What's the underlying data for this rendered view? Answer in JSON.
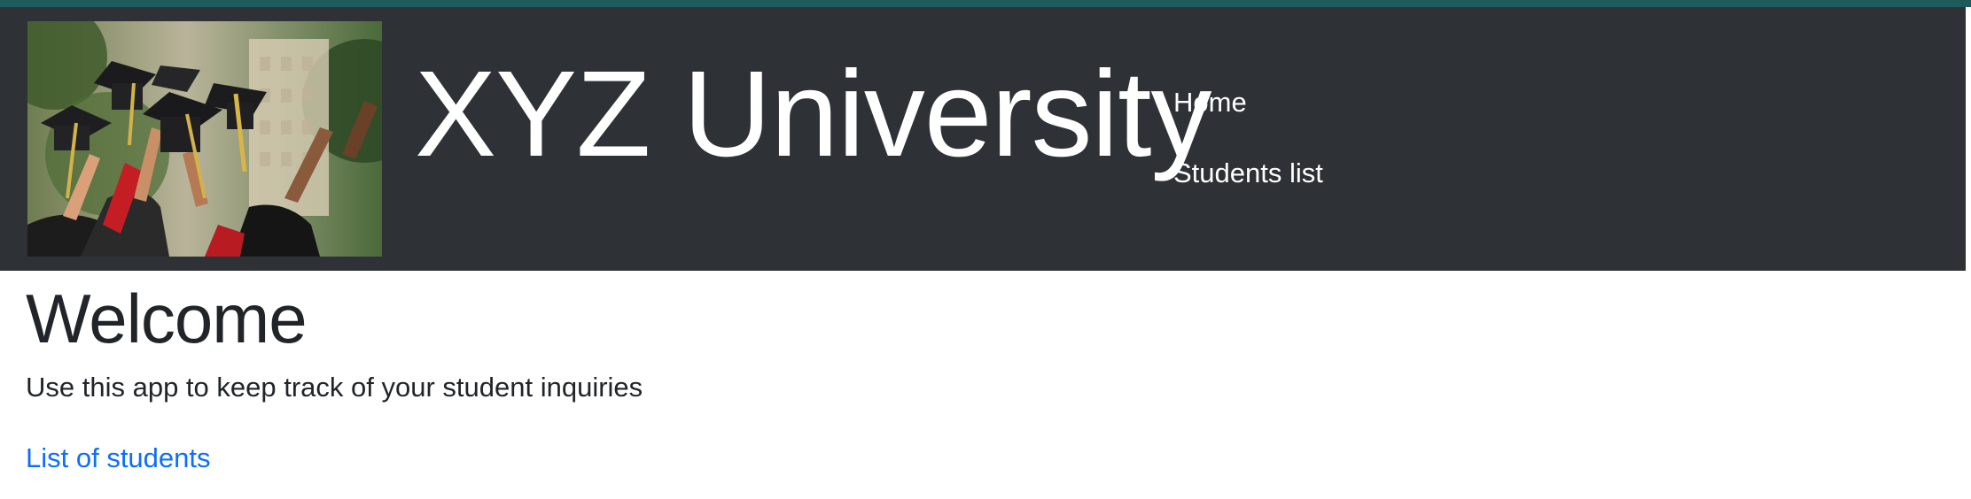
{
  "header": {
    "brand_title": "XYZ University",
    "nav": [
      {
        "label": "Home"
      },
      {
        "label": "Students list"
      }
    ],
    "colors": {
      "header_bg": "#2e3236",
      "top_strip": "#1f5a5c"
    }
  },
  "main": {
    "title": "Welcome",
    "description": "Use this app to keep track of your student inquiries",
    "link_label": "List of students",
    "link_color": "#0d6efd"
  }
}
